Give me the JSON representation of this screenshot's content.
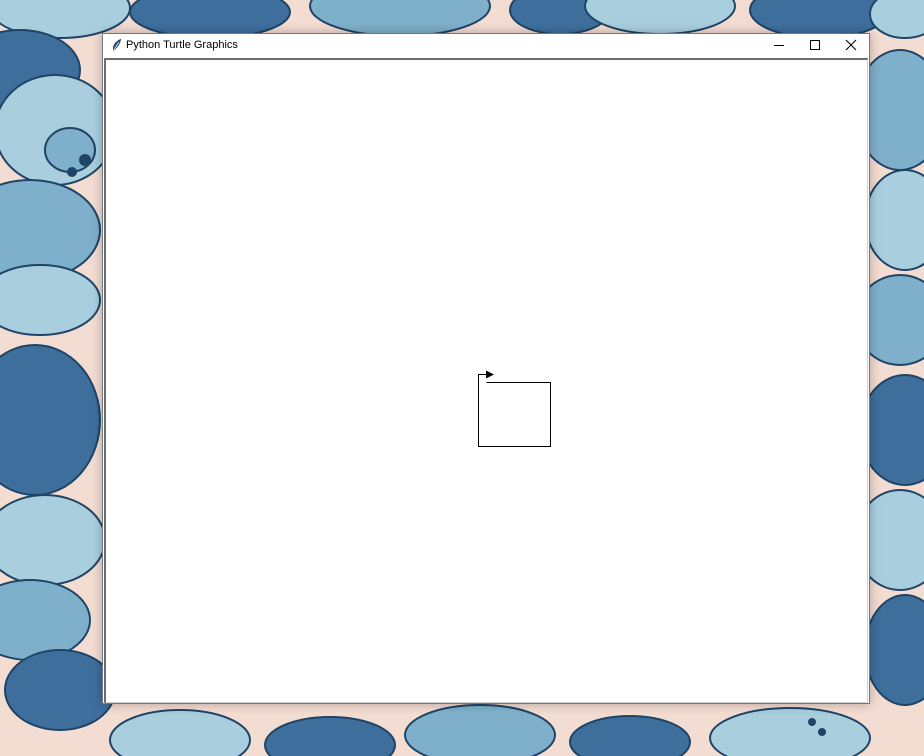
{
  "window": {
    "title": "Python Turtle Graphics",
    "icon": "feather-icon",
    "buttons": {
      "minimize": "minimize-icon",
      "maximize": "maximize-icon",
      "close": "close-icon"
    }
  },
  "canvas": {
    "background": "#ffffff",
    "pen_color": "#000000",
    "turtle_shape": "arrow"
  },
  "wallpaper": {
    "colors": {
      "background": "#f3dcd2",
      "light_petal": "#a9cfdf",
      "mid_petal": "#7fb0cb",
      "dark_leaf": "#3e6f9c",
      "outline": "#1f4466"
    }
  }
}
